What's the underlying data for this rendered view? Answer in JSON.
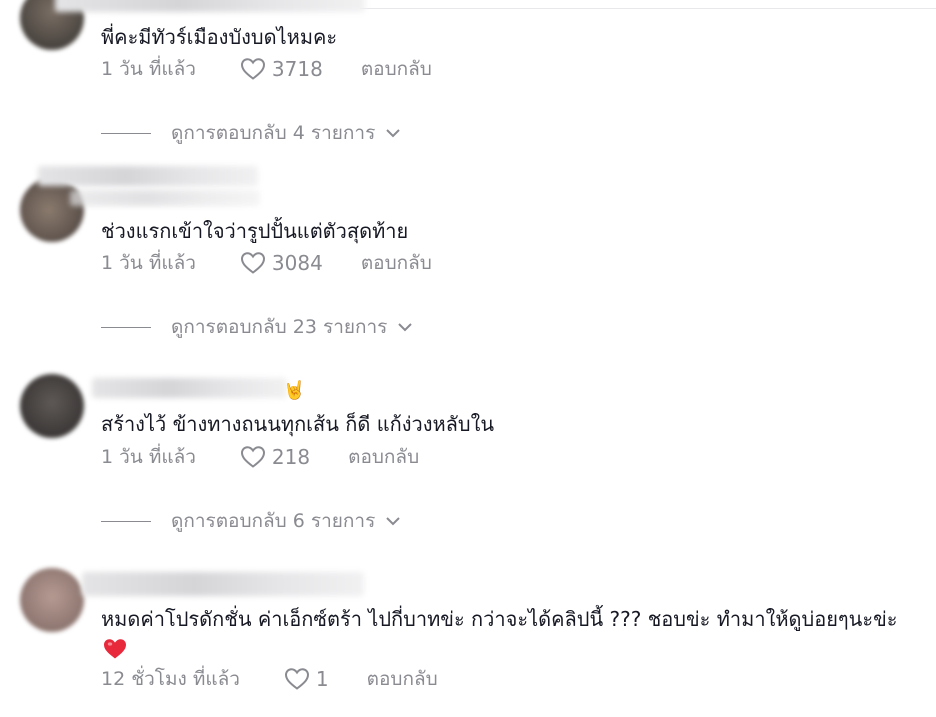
{
  "comments": [
    {
      "text": "พี่คะมีทัวร์เมืองบังบดไหมคะ",
      "time": "1 วัน ที่แล้ว",
      "likes": "3718",
      "reply_label": "ตอบกลับ",
      "view_replies": "ดูการตอบกลับ 4 รายการ"
    },
    {
      "text": "ช่วงแรกเข้าใจว่ารูปปั้นแต่ตัวสุดท้าย",
      "time": "1 วัน ที่แล้ว",
      "likes": "3084",
      "reply_label": "ตอบกลับ",
      "view_replies": "ดูการตอบกลับ 23 รายการ"
    },
    {
      "text": "สร้างไว้ ข้างทางถนนทุกเส้น ก็ดี แก้ง่วงหลับใน",
      "time": "1 วัน ที่แล้ว",
      "likes": "218",
      "reply_label": "ตอบกลับ",
      "view_replies": "ดูการตอบกลับ 6 รายการ",
      "name_emoji": "🤘"
    },
    {
      "text": "หมดค่าโปรดักชั่น ค่าเอ็กซ์ตร้า ไปกี่บาทข่ะ กว่าจะได้คลิปนี้ ??? ชอบข่ะ ทำมาให้ดูบ่อยๆนะข่ะ",
      "emoji": "❤️",
      "time": "12 ชั่วโมง ที่แล้ว",
      "likes": "1",
      "reply_label": "ตอบกลับ"
    }
  ],
  "colors": {
    "text": "#161823",
    "muted": "#8a8b91",
    "heart_emoji": "#e8293b"
  },
  "icons": {
    "like": "heart-outline-icon",
    "expand": "chevron-down-icon"
  }
}
